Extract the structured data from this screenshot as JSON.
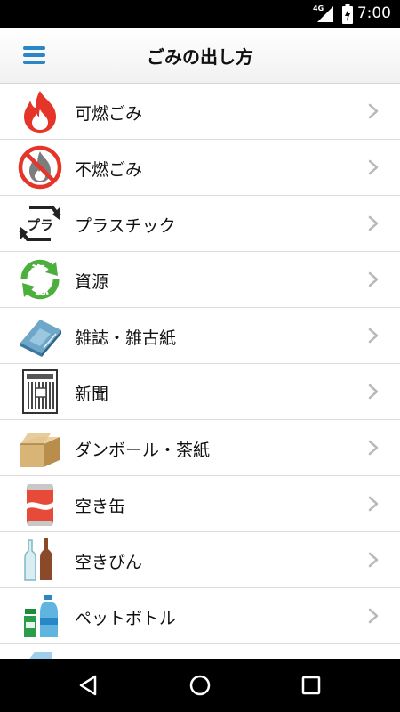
{
  "status_bar": {
    "network": "4G",
    "time": "7:00",
    "signal_icon": "signal-icon",
    "battery_icon": "battery-charging-icon"
  },
  "app_bar": {
    "menu_icon": "hamburger-menu-icon",
    "title": "ごみの出し方"
  },
  "categories": [
    {
      "label": "可燃ごみ",
      "icon": "flame-icon"
    },
    {
      "label": "不燃ごみ",
      "icon": "no-burn-icon"
    },
    {
      "label": "プラスチック",
      "icon": "plastic-recycle-icon"
    },
    {
      "label": "資源",
      "icon": "resource-recycle-icon"
    },
    {
      "label": "雑誌・雑古紙",
      "icon": "magazine-icon"
    },
    {
      "label": "新聞",
      "icon": "newspaper-icon"
    },
    {
      "label": "ダンボール・茶紙",
      "icon": "cardboard-box-icon"
    },
    {
      "label": "空き缶",
      "icon": "can-icon"
    },
    {
      "label": "空きびん",
      "icon": "bottles-icon"
    },
    {
      "label": "ペットボトル",
      "icon": "pet-bottle-icon"
    },
    {
      "label": "",
      "icon": "milk-carton-icon"
    }
  ],
  "colors": {
    "accent": "#2a86c6",
    "flame": "#e53528",
    "recycle_green": "#4cae3c",
    "divider": "#dcdcdc",
    "chevron": "#b9b9b9"
  },
  "nav_bar": {
    "back_icon": "back-triangle-icon",
    "home_icon": "home-circle-icon",
    "recents_icon": "recents-square-icon"
  }
}
